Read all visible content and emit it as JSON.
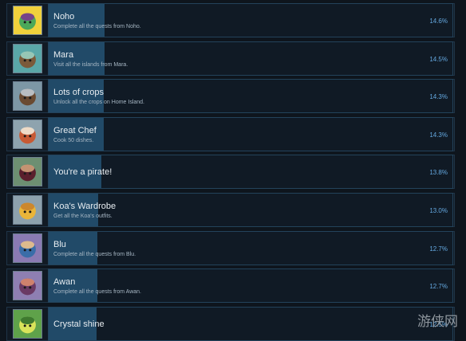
{
  "achievements": [
    {
      "title": "Noho",
      "description": "Complete all the quests from Noho.",
      "percent": "14.6%",
      "percent_value": 14.6,
      "icon": "noho-character-icon",
      "icon_colors": [
        "#f0d13c",
        "#4ba85a",
        "#7a3a8e"
      ]
    },
    {
      "title": "Mara",
      "description": "Visit all the islands from Mara.",
      "percent": "14.5%",
      "percent_value": 14.5,
      "icon": "raft-island-icon",
      "icon_colors": [
        "#5aa7a8",
        "#7b5a3a",
        "#9ad1c3"
      ]
    },
    {
      "title": "Lots of crops",
      "description": "Unlock all the crops on Home Island.",
      "percent": "14.3%",
      "percent_value": 14.3,
      "icon": "hoe-tool-icon",
      "icon_colors": [
        "#7d97a5",
        "#6a4a31",
        "#c2cad1"
      ]
    },
    {
      "title": "Great Chef",
      "description": "Cook 50 dishes.",
      "percent": "14.3%",
      "percent_value": 14.3,
      "icon": "chef-character-icon",
      "icon_colors": [
        "#8ea3ae",
        "#c75a34",
        "#f2e9d7"
      ]
    },
    {
      "title": "You're a pirate!",
      "description": "",
      "percent": "13.8%",
      "percent_value": 13.8,
      "icon": "pirate-character-icon",
      "icon_colors": [
        "#6d8f72",
        "#5a1f2d",
        "#cfa07a"
      ]
    },
    {
      "title": "Koa's Wardrobe",
      "description": "Get all the Koa's outfits.",
      "percent": "13.0%",
      "percent_value": 13.0,
      "icon": "shirt-icon",
      "icon_colors": [
        "#8da1ad",
        "#e9b53a",
        "#c9822c"
      ]
    },
    {
      "title": "Blu",
      "description": "Complete all the quests from Blu.",
      "percent": "12.7%",
      "percent_value": 12.7,
      "icon": "blu-character-icon",
      "icon_colors": [
        "#8a7ab3",
        "#3a6da8",
        "#f0c28a"
      ]
    },
    {
      "title": "Awan",
      "description": "Complete all the quests from Awan.",
      "percent": "12.7%",
      "percent_value": 12.7,
      "icon": "awan-character-icon",
      "icon_colors": [
        "#8e7fb2",
        "#6a3a64",
        "#d98a6e"
      ]
    },
    {
      "title": "Crystal shine",
      "description": "",
      "percent": "12.5%",
      "percent_value": 12.5,
      "icon": "crystal-orb-icon",
      "icon_colors": [
        "#5fa24a",
        "#d8e35a",
        "#2f6e2a"
      ]
    }
  ],
  "watermark": "游侠网"
}
